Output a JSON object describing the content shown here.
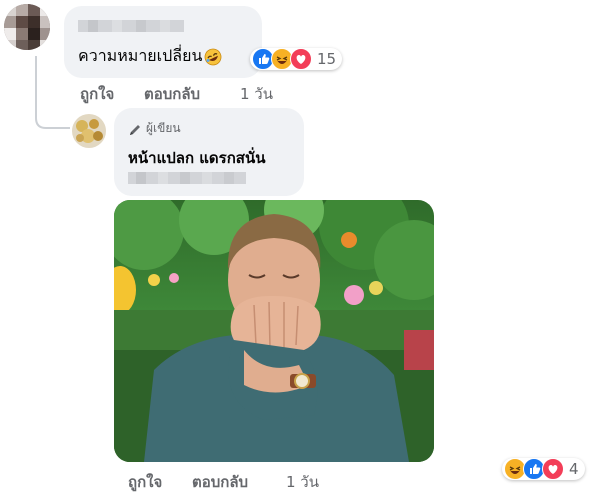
{
  "comment": {
    "author_name_blurred": true,
    "text": "ความหมายเปลี่ยน",
    "reactions": {
      "icons": [
        "like-icon",
        "haha-icon",
        "love-icon"
      ],
      "count": "15"
    },
    "actions": {
      "like": "ถูกใจ",
      "reply": "ตอบกลับ",
      "time": "1 วัน"
    }
  },
  "reply": {
    "badge": {
      "icon": "pencil-icon",
      "label": "ผู้เขียน"
    },
    "text": "หน้าแปลก แดรกสนั่น",
    "subtext_blurred": true,
    "image": {
      "description_icon": "photo-laughing-man"
    },
    "actions": {
      "like": "ถูกใจ",
      "reply": "ตอบกลับ",
      "time": "1 วัน"
    },
    "reactions": {
      "icons": [
        "haha-icon",
        "like-icon",
        "love-icon"
      ],
      "count": "4"
    }
  },
  "colors": {
    "bubble": "#f0f2f5",
    "like": "#1877f2",
    "love": "#f33e58",
    "haha": "#f7b125",
    "muted": "#65676b"
  }
}
